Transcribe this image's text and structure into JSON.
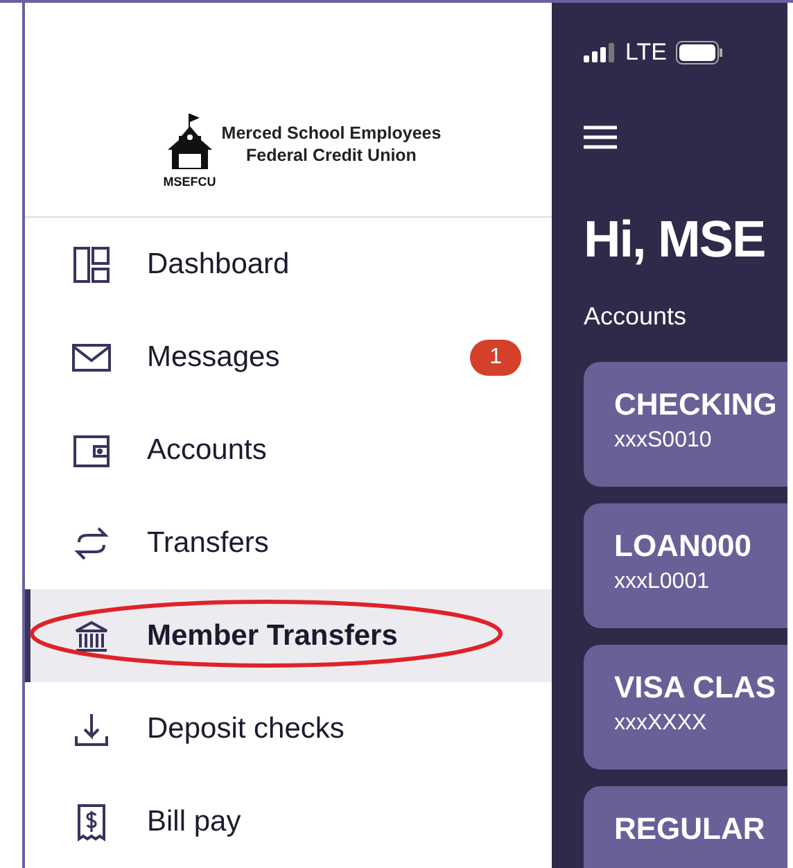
{
  "sidebar": {
    "logo": {
      "name_line1": "Merced School Employees",
      "name_line2": "Federal Credit Union",
      "abbreviation": "MSEFCU"
    },
    "items": [
      {
        "label": "Dashboard",
        "selected": false,
        "circled": false
      },
      {
        "label": "Messages",
        "selected": false,
        "circled": false,
        "badge": "1"
      },
      {
        "label": "Accounts",
        "selected": false,
        "circled": false
      },
      {
        "label": "Transfers",
        "selected": false,
        "circled": false
      },
      {
        "label": "Member Transfers",
        "selected": true,
        "circled": true
      },
      {
        "label": "Deposit checks",
        "selected": false,
        "circled": false
      },
      {
        "label": "Bill pay",
        "selected": false,
        "circled": false
      }
    ]
  },
  "main": {
    "status_bar": {
      "network": "LTE"
    },
    "greeting": "Hi, MSE",
    "section_title": "Accounts",
    "accounts": [
      {
        "name": "CHECKING",
        "number": "xxxS0010"
      },
      {
        "name": "LOAN000",
        "number": "xxxL0001"
      },
      {
        "name": "VISA CLAS",
        "number": "xxxXXXX"
      },
      {
        "name": "REGULAR"
      }
    ]
  }
}
